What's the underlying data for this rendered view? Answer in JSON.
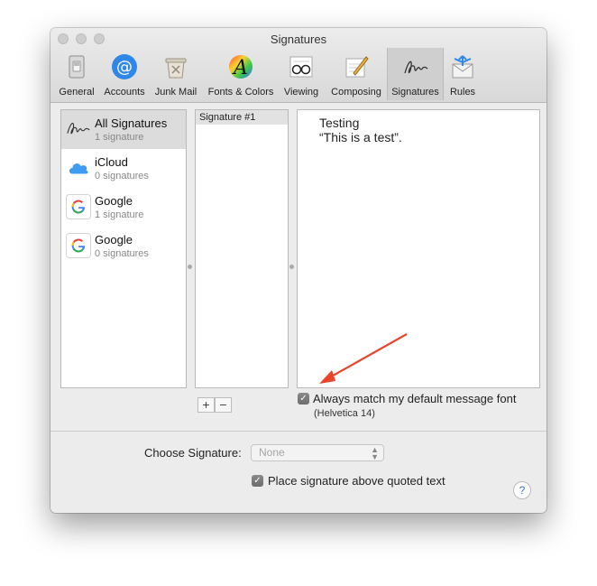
{
  "window": {
    "title": "Signatures"
  },
  "toolbar": {
    "items": [
      {
        "label": "General",
        "icon": "switch-icon"
      },
      {
        "label": "Accounts",
        "icon": "at-icon"
      },
      {
        "label": "Junk Mail",
        "icon": "trash-icon"
      },
      {
        "label": "Fonts & Colors",
        "icon": "font-icon"
      },
      {
        "label": "Viewing",
        "icon": "glasses-icon"
      },
      {
        "label": "Composing",
        "icon": "pencil-icon"
      },
      {
        "label": "Signatures",
        "icon": "signature-icon",
        "active": true
      },
      {
        "label": "Rules",
        "icon": "rules-icon"
      }
    ]
  },
  "accounts": [
    {
      "name": "All Signatures",
      "count": "1 signature",
      "icon": "signature-icon",
      "selected": true
    },
    {
      "name": "iCloud",
      "count": "0 signatures",
      "icon": "cloud-icon"
    },
    {
      "name": "Google",
      "count": "1 signature",
      "icon": "google-icon"
    },
    {
      "name": "Google",
      "count": "0 signatures",
      "icon": "google-icon"
    }
  ],
  "signatures": {
    "items": [
      "Signature #1"
    ],
    "add_label": "+",
    "remove_label": "−"
  },
  "editor": {
    "lines": [
      "Testing",
      "“This is a test”."
    ]
  },
  "font_option": {
    "label": "Always match my default message font",
    "detail": "(Helvetica 14)",
    "checked": true
  },
  "choose": {
    "label": "Choose Signature:",
    "value": "None"
  },
  "place_option": {
    "label": "Place signature above quoted text",
    "checked": true
  },
  "help": {
    "label": "?"
  },
  "colors": {
    "annotation_arrow": "#e8452c",
    "accent": "#3c76d4"
  }
}
